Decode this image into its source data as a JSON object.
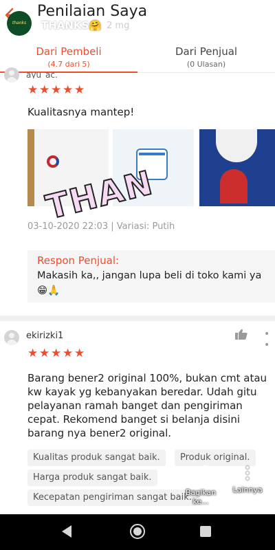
{
  "header": {
    "title": "Penilaian Saya",
    "story_user": "THANKS🤗",
    "story_time": "2 mg",
    "story_avatar_text": "thanks"
  },
  "tabs": [
    {
      "label": "Dari Pembeli",
      "sub": "(4.7 dari 5)",
      "active": true
    },
    {
      "label": "Dari Penjual",
      "sub": "(0 Ulasan)",
      "active": false
    }
  ],
  "review1": {
    "username": "ayu_ac.",
    "rating": 5,
    "text": "Kualitasnya mantep!",
    "overlay": "THAN",
    "meta": "03-10-2020 22:03 | Variasi: Putih",
    "response_title": "Respon Penjual:",
    "response_text": "Makasih ka,, jangan lupa beli di toko kami ya 😁🙏"
  },
  "review2": {
    "username": "ekirizki1",
    "rating": 5,
    "text": "Barang bener2 original 100%, bukan cmt atau kw kayak yg kebanyakan beredar. Udah gitu pelayanan ramah banget dan pengiriman cepat. Rekomend banget si belanja disini barang nya bener2 original.",
    "tags": [
      "Kualitas produk sangat baik.",
      "Produk original.",
      "Harga produk sangat baik.",
      "Kecepatan pengiriman sangat baik."
    ]
  },
  "actions": {
    "share_label": "Bagikan ke...",
    "more_label": "Lainnya"
  },
  "colors": {
    "accent": "#ee4d2d",
    "star": "#ee4d2d"
  }
}
